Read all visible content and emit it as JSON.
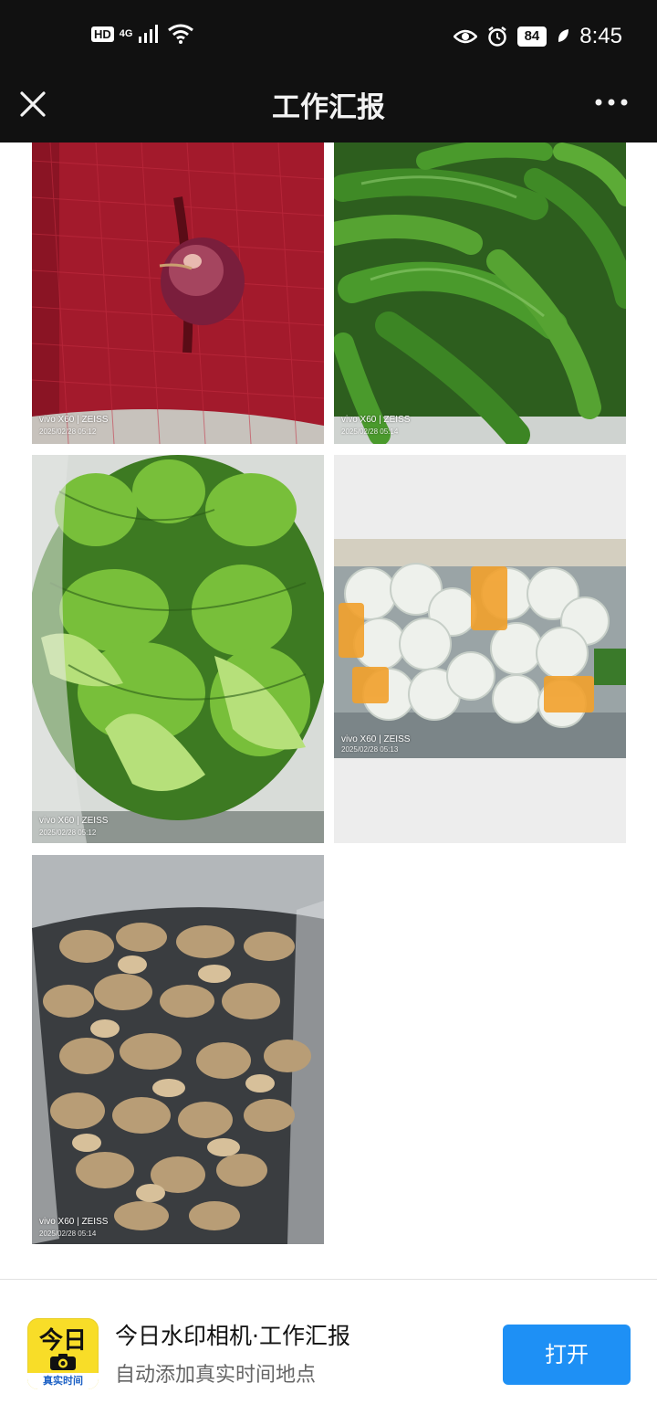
{
  "status_bar": {
    "hd": "HD",
    "network": "4G",
    "battery": "84",
    "time": "8:45"
  },
  "header": {
    "title": "工作汇报",
    "close_icon": "close-icon",
    "more_icon": "more-icon"
  },
  "photos": [
    {
      "subject": "red onion",
      "brand": "vivo X60 | ZEISS",
      "date": "2025/02/28 05:12"
    },
    {
      "subject": "green peppers",
      "brand": "vivo X60 | ZEISS",
      "date": "2025/02/28 05:14"
    },
    {
      "subject": "mustard greens",
      "brand": "vivo X60 | ZEISS",
      "date": "2025/02/28 05:12"
    },
    {
      "subject": "bagged cabbages",
      "brand": "vivo X60 | ZEISS",
      "date": "2025/02/28 05:13"
    },
    {
      "subject": "ginger",
      "brand": "vivo X60 | ZEISS",
      "date": "2025/02/28 05:14"
    }
  ],
  "banner": {
    "icon_top": "今日",
    "icon_sub": "真实时间",
    "app_name": "今日水印相机·工作汇报",
    "app_desc": "自动添加真实时间地点",
    "open_label": "打开",
    "accent": "#1e90f5"
  }
}
